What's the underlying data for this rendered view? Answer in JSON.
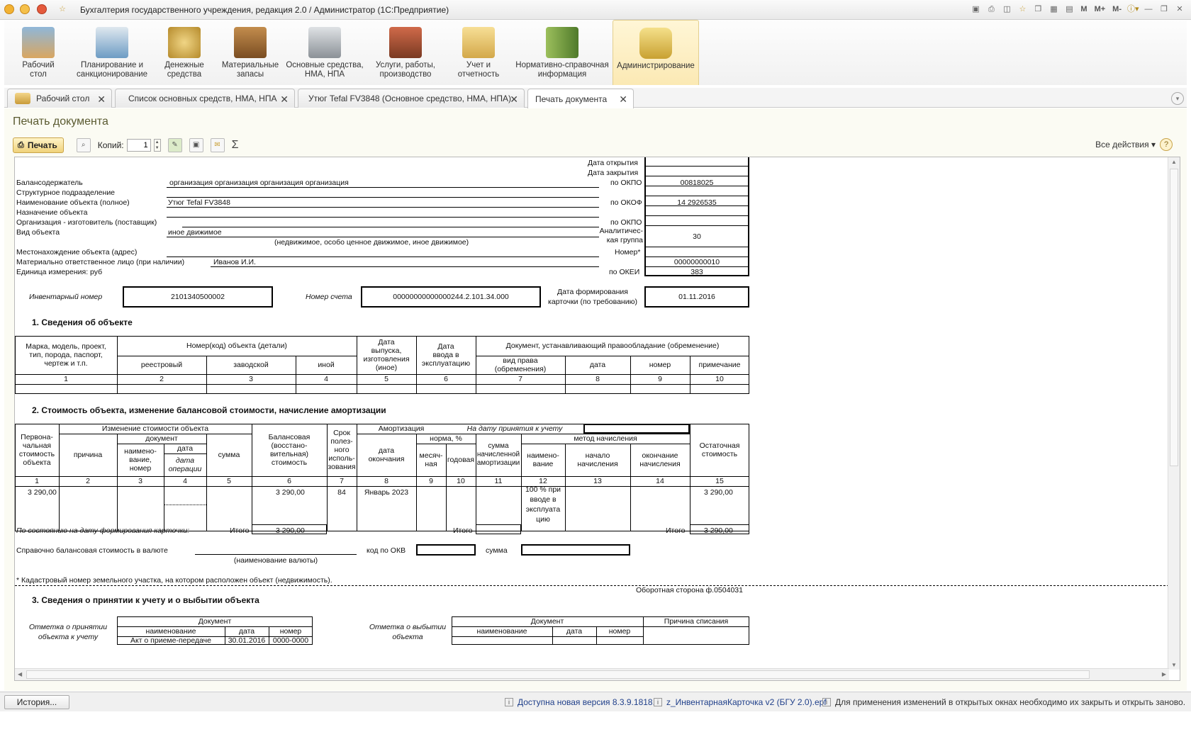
{
  "window": {
    "title": "Бухгалтерия государственного учреждения, редакция 2.0 / Администратор  (1С:Предприятие)",
    "tools": [
      "M",
      "M+",
      "M-"
    ]
  },
  "sections": [
    {
      "label": "Рабочий\nстол"
    },
    {
      "label": "Планирование и\nсанкционирование"
    },
    {
      "label": "Денежные\nсредства"
    },
    {
      "label": "Материальные\nзапасы"
    },
    {
      "label": "Основные средства,\nНМА, НПА"
    },
    {
      "label": "Услуги, работы,\nпроизводство"
    },
    {
      "label": "Учет и\nотчетность"
    },
    {
      "label": "Нормативно-справочная\nинформация"
    },
    {
      "label": "Администрирование"
    }
  ],
  "tabs": [
    {
      "label": "Рабочий стол"
    },
    {
      "label": "Список основных средств, НМА, НПА"
    },
    {
      "label": "Утюг Tefal FV3848 (Основное средство, НМА, НПА)"
    },
    {
      "label": "Печать документа"
    }
  ],
  "page": {
    "title": "Печать документа",
    "print_label": "Печать",
    "copies_label": "Копий:",
    "copies_value": "1",
    "all_actions": "Все действия ▾",
    "help": "?"
  },
  "doc": {
    "header": {
      "open_date": "Дата открытия",
      "close_date": "Дата закрытия",
      "holder_label": "Балансодержатель",
      "holder_value": "организация организация организация организация",
      "okpo_label": "по ОКПО",
      "okpo_value": "00818025",
      "struct_label": "Структурное подразделение",
      "object_name_label": "Наименование объекта (полное)",
      "object_name_value": "Утюг Tefal FV3848",
      "okof_label": "по ОКОФ",
      "okof_value": "14 2926535",
      "purpose_label": "Назначение объекта",
      "maker_label": "Организация - изготовитель (поставщик)",
      "maker_okpo_label": "по ОКПО",
      "kind_label": "Вид объекта",
      "kind_value": "иное движимое",
      "kind_hint": "(недвижимое, особо ценное движимое, иное движимое)",
      "analytic_label": "Аналитичес-\nкая группа",
      "analytic_value": "30",
      "location_label": "Местонахождение объекта (адрес)",
      "number_label": "Номер*",
      "mol_label": "Материально ответственное лицо (при наличии)",
      "mol_value": "Иванов И.И.",
      "mol_code": "00000000010",
      "unit_label": "Единица измерения: руб",
      "okei_label": "по ОКЕИ",
      "okei_value": "383",
      "inv_label": "Инвентарный номер",
      "inv_value": "2101340500002",
      "account_label": "Номер счета",
      "account_value": "00000000000000244.2.101.34.000",
      "formdate_label": "Дата формирования\nкарточки (по требованию)",
      "formdate_value": "01.11.2016"
    },
    "s1": {
      "title": "1. Сведения об объекте",
      "h_brand": "Марка, модель, проект,\nтип, порода, паспорт,\nчертеж и т.п.",
      "h_number": "Номер(код) объекта (детали)",
      "h_registry": "реестровый",
      "h_factory": "заводской",
      "h_other": "иной",
      "h_release": "Дата\nвыпуска,\nизготовления\n(иное)",
      "h_commission": "Дата\nввода в\nэксплуатацию",
      "h_doc": "Документ, устанавливающий правообладание (обременение)",
      "h_right": "вид права\n(обременения)",
      "h_date": "дата",
      "h_num": "номер",
      "h_note": "примечание",
      "nums": [
        "1",
        "2",
        "3",
        "4",
        "5",
        "6",
        "7",
        "8",
        "9",
        "10"
      ]
    },
    "s2": {
      "title": "2. Стоимость объекта, изменение балансовой стоимости, начисление амортизации",
      "h_initial": "Первона-\nчальная\nстоимость\nобъекта",
      "h_change": "Изменение стоимости объекта",
      "h_reason": "причина",
      "h_document": "документ",
      "h_docname": "наимено-\nвание,\nномер",
      "h_date": "дата",
      "h_opdate": "дата\nоперации",
      "h_sum": "сумма",
      "h_balance": "Балансовая\n(восстано-\nвительная)\nстоимость",
      "h_term": "Срок\nполез-\nного\nисполь-\nзования",
      "h_amort": "Амортизация",
      "h_atdate": "На дату принятия к учету",
      "h_enddate": "дата\nокончания",
      "h_norm": "норма, %",
      "h_monthly": "месяч-\nная",
      "h_yearly": "годовая",
      "h_accrued": "сумма\nначисленной\nамортизации",
      "h_method": "метод начисления",
      "h_methodname": "наимено-\nвание",
      "h_start": "начало\nначисления",
      "h_end": "окончание\nначисления",
      "h_residual": "Остаточная\nстоимость",
      "nums": [
        "1",
        "2",
        "3",
        "4",
        "5",
        "6",
        "7",
        "8",
        "9",
        "10",
        "11",
        "12",
        "13",
        "14",
        "15"
      ],
      "row_initial": "3 290,00",
      "row_balance": "3 290,00",
      "row_term": "84",
      "row_end": "Январь 2023",
      "row_method": "100 % при\nвводе в\nэксплуата\nцию",
      "row_residual": "3 290,00",
      "state_label": "По состоянию на дату формирования карточки:",
      "itogo": "Итого",
      "itogo_balance": "3 290,00",
      "itogo_residual": "3 290,00",
      "ref_label": "Справочно балансовая стоимость в валюте",
      "currency_hint": "(наименование валюты)",
      "okv_label": "код по ОКВ",
      "sum_label": "сумма",
      "cadastre_note": "* Кадастровый номер земельного участка, на котором расположен объект (недвижимость).",
      "reverse": "Оборотная сторона ф.0504031"
    },
    "s3": {
      "title": "3. Сведения о принятии к учету и о выбытии объекта",
      "accept_label": "Отметка о принятии\nобъекта к учету",
      "dispose_label": "Отметка о выбытии\nобъекта",
      "h_document": "Документ",
      "h_name": "наименование",
      "h_date": "дата",
      "h_number": "номер",
      "h_reason": "Причина списания",
      "row_name": "Акт о приеме-передаче",
      "row_date": "30.01.2016",
      "row_num": "0000-0000"
    }
  },
  "status": {
    "history": "История...",
    "msg1": "Доступна новая версия 8.3.9.1818.",
    "msg2": "z_ИнвентарнаяКарточка v2 (БГУ 2.0).epf",
    "msg3": "Для применения изменений в открытых окнах необходимо их закрыть и открыть заново."
  },
  "colors": {
    "accent": "#f0d27a",
    "title": "#5a5a30",
    "link": "#1f3f8a"
  }
}
